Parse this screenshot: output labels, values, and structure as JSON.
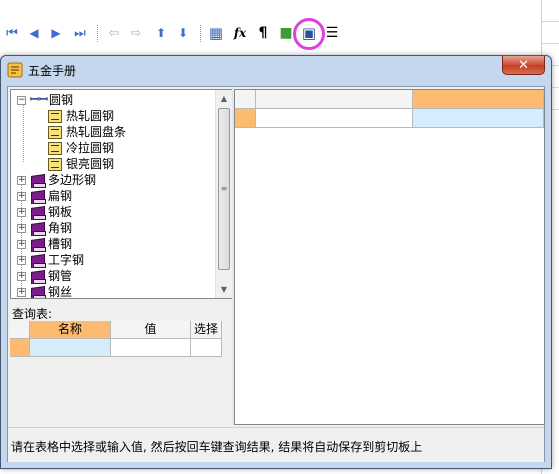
{
  "dialog": {
    "title": "五金手册",
    "close_label": "✕"
  },
  "tree": {
    "root": {
      "label": "圆钢",
      "expander": "−"
    },
    "children": [
      "热轧圆钢",
      "热轧圆盘条",
      "冷拉圆钢",
      "银亮圆钢"
    ],
    "categories": [
      "多边形钢",
      "扁钢",
      "钢板",
      "角钢",
      "槽钢",
      "工字钢",
      "钢管",
      "钢丝"
    ],
    "collapsed_expander": "+"
  },
  "query": {
    "label": "查询表:",
    "columns": [
      "名称",
      "值",
      "选择"
    ]
  },
  "status": {
    "text": "请在表格中选择或输入值, 然后按回车键查询结果, 结果将自动保存到剪切板上"
  },
  "colors": {
    "selected_header": "#fdbb72",
    "selected_cell": "#d4ecfc",
    "highlight": "#e040e0"
  },
  "toolbar_icons": [
    "first-record-icon",
    "prev-record-icon",
    "next-record-icon",
    "last-record-icon",
    "cut-icon",
    "forward-icon",
    "move-up-icon",
    "move-down-icon",
    "calculator-icon",
    "function-icon",
    "paragraph-icon",
    "cube-icon",
    "handbook-icon",
    "list-icon"
  ],
  "toolbar_glyphs": {
    "first": "⏮",
    "prev": "◀",
    "next": "▶",
    "last": "⏭",
    "cut": "⇦",
    "fwd": "⇨",
    "up": "⬆",
    "down": "⬇",
    "calc": "▦",
    "fx": "fx",
    "para": "¶",
    "cube": "■",
    "book": "▣",
    "list": "☰"
  }
}
